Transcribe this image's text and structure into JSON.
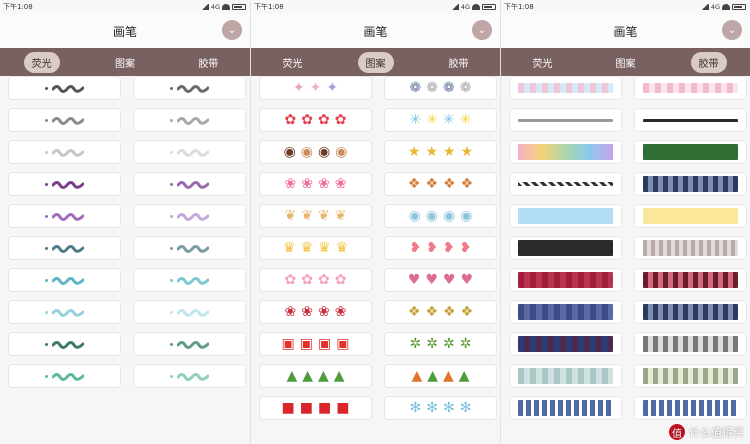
{
  "status": {
    "time": "下午1:08",
    "right_text": "4G"
  },
  "panels": [
    {
      "title": "画笔",
      "tabs": [
        "荧光",
        "图案",
        "胶带"
      ],
      "active_tab": "荧光"
    },
    {
      "title": "画笔",
      "tabs": [
        "荧光",
        "图案",
        "胶带"
      ],
      "active_tab": "图案"
    },
    {
      "title": "画笔",
      "tabs": [
        "荧光",
        "图案",
        "胶带"
      ],
      "active_tab": "胶带"
    }
  ],
  "colors": {
    "tabbar": "#7a6161",
    "active_tab_bg": "#d9cbc7",
    "dropdown": "#bfa6a6"
  },
  "brush_colors_left": [
    "#555555",
    "#8a8a8a",
    "#c7c7c7",
    "#7a3f88",
    "#a06bc0",
    "#4e7c86",
    "#5fb3c5",
    "#94d1df",
    "#3d7b66",
    "#5fb89e"
  ],
  "brush_colors_right": [
    "#6a6a6a",
    "#a8a8a8",
    "#dcdcdc",
    "#9a6ab0",
    "#c5a7dc",
    "#7a9aa3",
    "#7ec8d6",
    "#bfe6ef",
    "#5e9c88",
    "#8dd0bb"
  ],
  "patterns_left": [
    [
      "#e9a1b8",
      "#f0b0c6",
      "#a3a0d8"
    ],
    [
      "#e5424d",
      "#e5424d",
      "#e5424d",
      "#e5424d"
    ],
    [
      "#6b3b25",
      "#c98b5a",
      "#6b3b25",
      "#c98b5a"
    ],
    [
      "#f36aa0",
      "#f36aa0",
      "#f36aa0",
      "#f36aa0"
    ],
    [
      "#e7b56b",
      "#e7b56b",
      "#e7b56b",
      "#e7b56b"
    ],
    [
      "#f6c23d",
      "#f6c23d",
      "#f6c23d",
      "#f6c23d"
    ],
    [
      "#f5a3b4",
      "#f5a3b4",
      "#f5a3b4",
      "#f5a3b4"
    ],
    [
      "#c92d3b",
      "#c92d3b",
      "#c92d3b",
      "#c92d3b"
    ],
    [
      "#e2322c",
      "#e2322c",
      "#e2322c",
      "#e2322c"
    ],
    [
      "#4f9c3d",
      "#4f9c3d",
      "#4f9c3d",
      "#4f9c3d"
    ],
    [
      "#d8262a",
      "#d8262a",
      "#d8262a",
      "#d8262a"
    ]
  ],
  "patterns_right": [
    [
      "#6a7da0",
      "#aaaaaa",
      "#6a7da0",
      "#aaaaaa"
    ],
    [
      "#7ac3e0",
      "#f2d33b",
      "#7ac3e0",
      "#f2d33b"
    ],
    [
      "#e9b635",
      "#e9b635",
      "#e9b635",
      "#e9b635"
    ],
    [
      "#d27e3a",
      "#d27e3a",
      "#d27e3a",
      "#d27e3a"
    ],
    [
      "#8cc5dc",
      "#8cc5dc",
      "#8cc5dc",
      "#8cc5dc"
    ],
    [
      "#f07a8c",
      "#f07a8c",
      "#f07a8c",
      "#f07a8c"
    ],
    [
      "#de6d94",
      "#de6d94",
      "#de6d94",
      "#de6d94"
    ],
    [
      "#c6a136",
      "#c6a136",
      "#c6a136",
      "#c6a136"
    ],
    [
      "#5c9a33",
      "#5c9a33",
      "#5c9a33",
      "#5c9a33"
    ],
    [
      "#e0742d",
      "#4f9c3d",
      "#e0742d",
      "#4f9c3d"
    ],
    [
      "#7fc1d8",
      "#7fc1d8",
      "#7fc1d8",
      "#7fc1d8"
    ]
  ],
  "tapes_left": [
    "pastel",
    "thin lineonly",
    "rainbow",
    "hatch stripe",
    "sky",
    "dark",
    "red",
    "blue",
    "navy",
    "teal",
    "blueprint"
  ],
  "tapes_right": [
    "pink",
    "dark lineonly",
    "leaf",
    "ink",
    "yellow",
    "grid",
    "maroon",
    "ink",
    "silver",
    "beige",
    "blueprint"
  ],
  "pattern_glyphs": [
    "✦",
    "✿",
    "◉",
    "❀",
    "❦",
    "♛",
    "✿",
    "❀",
    "▣",
    "▲",
    "■"
  ],
  "pattern_glyphs_right": [
    "❁",
    "✳",
    "★",
    "❖",
    "◉",
    "❥",
    "♥",
    "❖",
    "✲",
    "▲",
    "✻"
  ],
  "watermark": {
    "logo": "值",
    "text": "什么值得买"
  }
}
